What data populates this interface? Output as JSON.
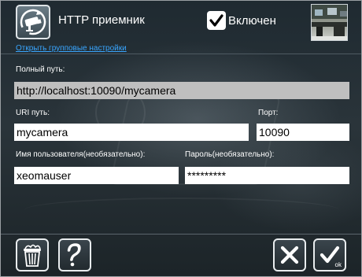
{
  "header": {
    "title": "HTTP приемник",
    "group_settings_link": "Открыть групповые настройки",
    "enabled": {
      "label": "Включен",
      "checked": true
    }
  },
  "form": {
    "full_path": {
      "label": "Полный путь:",
      "value": "http://localhost:10090/mycamera"
    },
    "uri_path": {
      "label": "URI путь:",
      "value": "mycamera"
    },
    "port": {
      "label": "Порт:",
      "value": "10090"
    },
    "username": {
      "label": "Имя пользователя(необязательно):",
      "value": "xeomauser"
    },
    "password": {
      "label": "Пароль(необязательно):",
      "value": "*********"
    }
  },
  "footer": {
    "ok_caption": "ok",
    "icons": {
      "delete": "trash-icon",
      "help": "question-mark-icon",
      "cancel": "close-icon",
      "ok": "checkmark-icon"
    }
  },
  "colors": {
    "link": "#39a6ff",
    "readonly_field": "#bfbfbf",
    "text": "#ffffff"
  }
}
